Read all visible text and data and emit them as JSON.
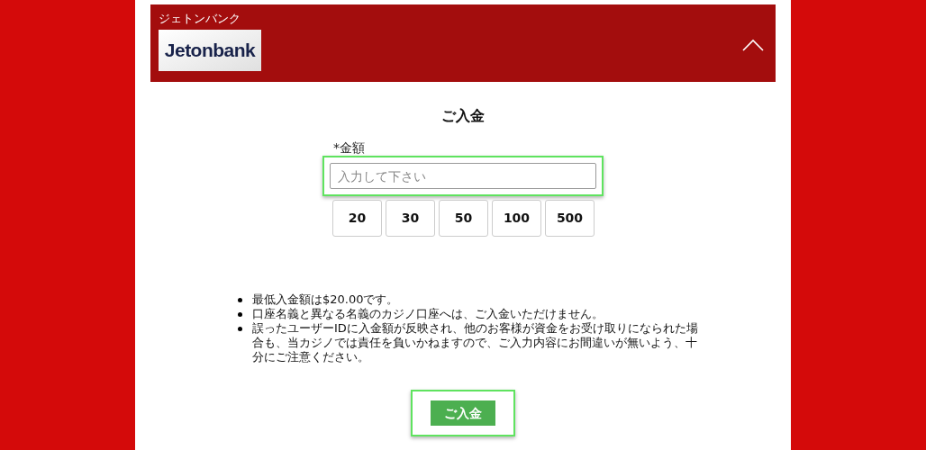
{
  "header": {
    "title": "ジェトンバンク",
    "logo": "Jetonbank",
    "expanded": true
  },
  "form": {
    "heading": "ご入金",
    "amount_label": "*金額",
    "amount_field": {
      "placeholder": "入力して下さい",
      "highlighted": true
    },
    "quick_amounts": [
      "20",
      "30",
      "50",
      "100",
      "500"
    ]
  },
  "notes": [
    "最低入金額は$20.00です。",
    "口座名義と異なる名義のカジノ口座へは、ご入金いただけません。",
    "誤ったユーザーIDに入金額が反映され、他のお客様が資金をお受け取りになられた場合も、当カジノでは責任を負いかねますので、ご入力内容にお間違いが無いよう、十分にご注意ください。"
  ],
  "submit": {
    "label": "ご入金",
    "highlighted": true
  }
}
